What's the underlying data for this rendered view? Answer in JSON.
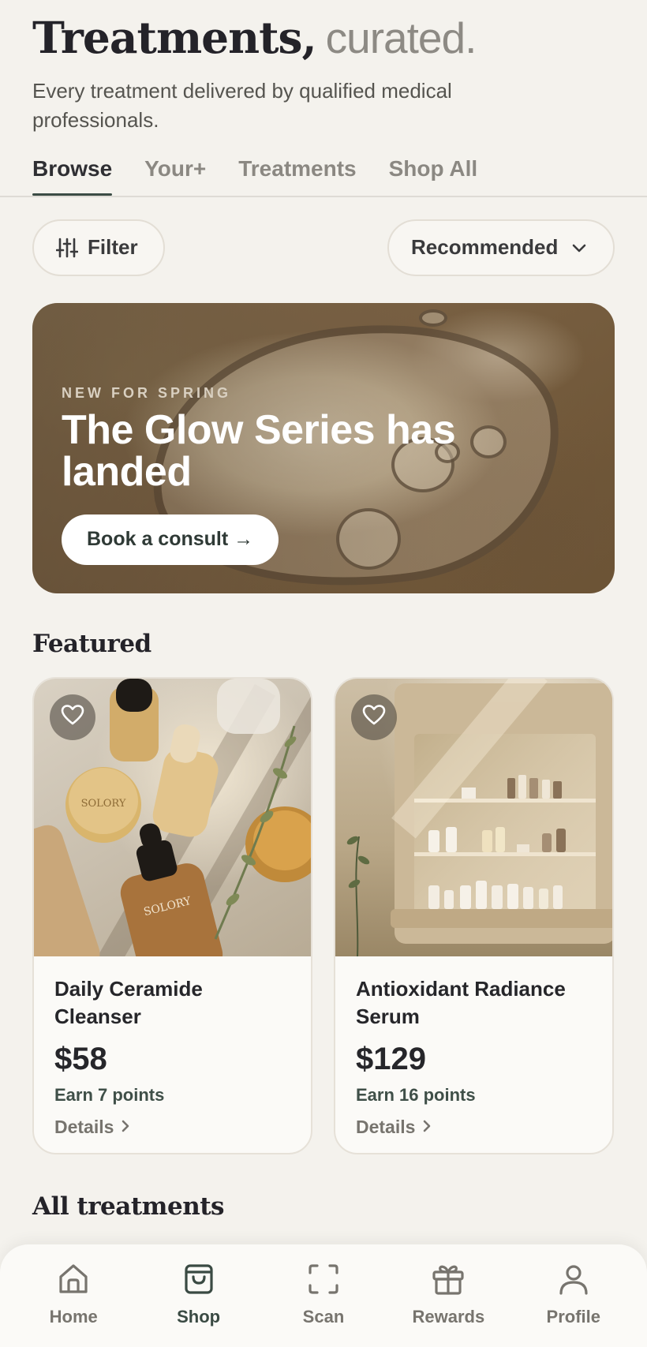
{
  "header": {
    "title_strong": "Treatments,",
    "title_light": "curated.",
    "subtitle": "Every treatment delivered by qualified medical professionals."
  },
  "tabs": [
    {
      "label": "Browse",
      "active": true
    },
    {
      "label": "Your+",
      "active": false
    },
    {
      "label": "Treatments",
      "active": false
    },
    {
      "label": "Shop All",
      "active": false
    }
  ],
  "filters": {
    "filter_label": "Filter",
    "sort_label": "Recommended"
  },
  "hero": {
    "eyebrow": "NEW FOR SPRING",
    "title": "The Glow Series has landed",
    "cta_label": "Book a consult →"
  },
  "featured": {
    "title": "Featured",
    "items": [
      {
        "name": "Daily Ceramide Cleanser",
        "price": "$58",
        "points": "Earn 7 points",
        "details_label": "Details"
      },
      {
        "name": "Antioxidant Radiance Serum",
        "price": "$129",
        "points": "Earn 16 points",
        "details_label": "Details"
      }
    ]
  },
  "all_treatments": {
    "title": "All treatments"
  },
  "product_brand": "SOLORY",
  "bottom_nav": [
    {
      "label": "Home",
      "icon": "home-icon",
      "active": false
    },
    {
      "label": "Shop",
      "icon": "bag-icon",
      "active": true
    },
    {
      "label": "Scan",
      "icon": "scan-icon",
      "active": false
    },
    {
      "label": "Rewards",
      "icon": "gift-icon",
      "active": false
    },
    {
      "label": "Profile",
      "icon": "person-icon",
      "active": false
    }
  ],
  "colors": {
    "background": "#f4f2ed",
    "accent": "#3b4c45",
    "muted_text": "#8b8882"
  }
}
